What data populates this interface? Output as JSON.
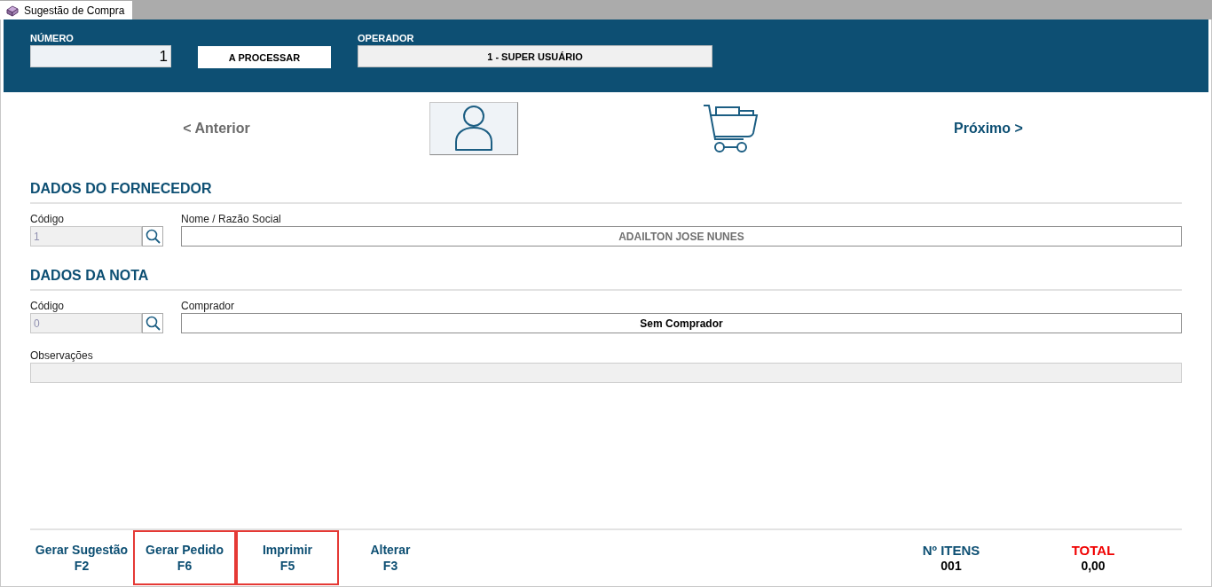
{
  "tab": {
    "label": "Sugestão de Compra",
    "selected": true
  },
  "header": {
    "numero": {
      "label": "NÚMERO",
      "value": "1"
    },
    "status": "A PROCESSAR",
    "operador": {
      "label": "OPERADOR",
      "value": "1 - SUPER USUÁRIO"
    }
  },
  "nav": {
    "previous": "< Anterior",
    "next": "Próximo >"
  },
  "sections": [
    {
      "title": "DADOS DO FORNECEDOR",
      "code": {
        "label": "Código",
        "value": "1"
      },
      "name": {
        "label": "Nome / Razão Social",
        "value": "ADAILTON JOSE NUNES",
        "kind": "muted"
      }
    },
    {
      "title": "DADOS DA NOTA",
      "code": {
        "label": "Código",
        "value": "0"
      },
      "name": {
        "label": "Comprador",
        "value": "Sem Comprador",
        "kind": "dark"
      }
    }
  ],
  "observacoes": {
    "label": "Observações"
  },
  "actions": [
    {
      "label": "Gerar Sugestão",
      "key": "F2",
      "outlined": false
    },
    {
      "label": "Gerar Pedido",
      "key": "F6",
      "outlined": true
    },
    {
      "label": "Imprimir",
      "key": "F5",
      "outlined": true
    },
    {
      "label": "Alterar",
      "key": "F3",
      "outlined": false
    }
  ],
  "totals": [
    {
      "label": "Nº ITENS",
      "value": "001",
      "kind": "count"
    },
    {
      "label": "TOTAL",
      "value": "0,00",
      "kind": "total"
    }
  ]
}
